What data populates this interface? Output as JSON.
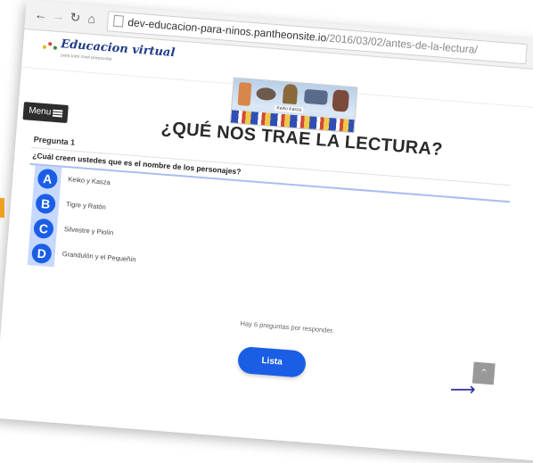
{
  "browser": {
    "url_host": "dev-educacion-para-ninos.pantheonsite.io",
    "url_path": "/2016/03/02/antes-de-la-lectura/"
  },
  "site": {
    "logo_text": "Educacion virtual",
    "logo_tagline": "para todo nivel preescolar"
  },
  "menu": {
    "label": "Menu"
  },
  "banner": {
    "caption": "Keiko Kasza"
  },
  "quiz": {
    "title": "¿QUÉ NOS TRAE LA LECTURA?",
    "question_number": "Pregunta 1",
    "question_text": "¿Cuál creen ustedes que es el nombre de los personajes?",
    "answers": [
      {
        "letter": "A",
        "text": "Keiko y Kasza"
      },
      {
        "letter": "B",
        "text": "Tigre y Ratón"
      },
      {
        "letter": "C",
        "text": "Silvestre y Piolín"
      },
      {
        "letter": "D",
        "text": "Grandulón y el Pequeñín"
      }
    ],
    "remaining": "Hay 6 preguntas por responder.",
    "submit_label": "Lista"
  },
  "colors": {
    "accent": "#1b5ee6",
    "answer_rail": "#c7d8ff",
    "menu_bg": "#2d2d2d"
  },
  "icons": {
    "back": "←",
    "forward": "→",
    "reload": "↻",
    "home": "⌂",
    "star": "☆",
    "search": "⌕",
    "scroll_top": "⌃",
    "arrow": "⟶"
  }
}
